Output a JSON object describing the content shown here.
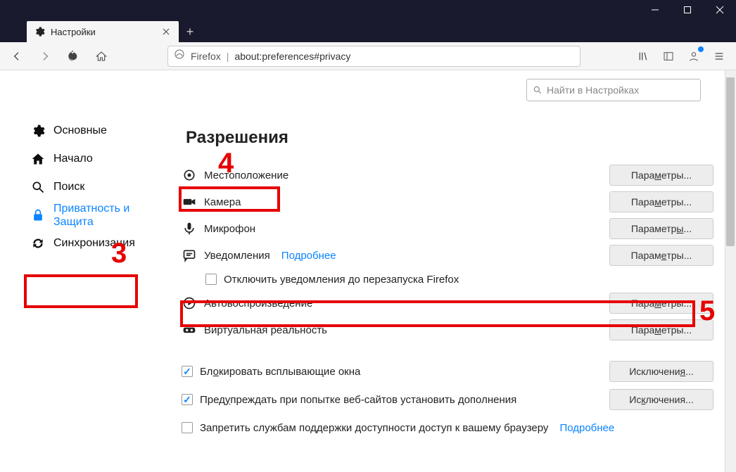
{
  "window": {
    "tab_title": "Настройки"
  },
  "url": {
    "protocol_label": "Firefox",
    "path": "about:preferences#privacy"
  },
  "sidebar": {
    "items": [
      {
        "label": "Основные"
      },
      {
        "label": "Начало"
      },
      {
        "label": "Поиск"
      },
      {
        "label": "Приватность и Защита"
      },
      {
        "label": "Синхронизация"
      }
    ]
  },
  "search": {
    "placeholder": "Найти в Настройках"
  },
  "section": {
    "title": "Разрешения"
  },
  "permissions": {
    "location": {
      "label": "Местоположение",
      "button_pre": "Пара",
      "button_u": "м",
      "button_post": "етры..."
    },
    "camera": {
      "label": "Камера",
      "button_pre": "Пара",
      "button_u": "м",
      "button_post": "етры..."
    },
    "microphone": {
      "label": "Микрофон",
      "button_pre": "Параметр",
      "button_u": "ы",
      "button_post": "..."
    },
    "notifications": {
      "label": "Уведомления",
      "link": "Подробнее",
      "button_pre": "Парам",
      "button_u": "е",
      "button_post": "тры..."
    },
    "notifications_pause": "Отключить уведомления до перезапуска Firefox",
    "autoplay": {
      "label": "Автовоспроизведение",
      "button_pre": "Пара",
      "button_u": "м",
      "button_post": "етры..."
    },
    "vr": {
      "label": "Виртуальная реальность",
      "button_pre": "Пара",
      "button_u": "м",
      "button_post": "етры..."
    }
  },
  "checks": {
    "popups": {
      "pre": "Бл",
      "u": "о",
      "post": "кировать всплывающие окна",
      "button_pre": "Исключени",
      "button_u": "я",
      "button_post": "..."
    },
    "addons": {
      "pre": "Пред",
      "u": "у",
      "post": "преждать при попытке веб-сайтов установить дополнения",
      "button_pre": "Ис",
      "button_u": "к",
      "button_post": "лючения..."
    },
    "a11y": {
      "label": "Запретить службам поддержки доступности доступ к вашему браузеру",
      "link": "Подробнее"
    }
  },
  "annotations": {
    "n3": "3",
    "n4": "4",
    "n5": "5"
  }
}
